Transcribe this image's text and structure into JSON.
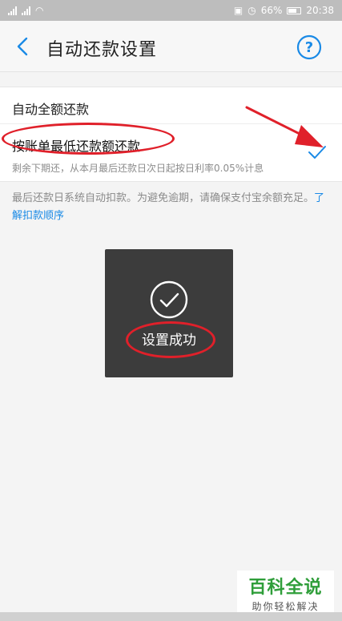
{
  "status_bar": {
    "battery": "66%",
    "time": "20:38"
  },
  "navbar": {
    "title": "自动还款设置",
    "back_icon": "chevron-left-icon",
    "help_icon": "question-circle-icon"
  },
  "options": [
    {
      "label": "自动全额还款",
      "selected": false
    },
    {
      "label": "按账单最低还款额还款",
      "sub": "剩余下期还，从本月最后还款日次日起按日利率0.05%计息",
      "selected": true
    }
  ],
  "info": {
    "text": "最后还款日系统自动扣款。为避免逾期，请确保支付宝余额充足。",
    "link": "了解扣款顺序"
  },
  "toast": {
    "icon": "check-circle-icon",
    "text": "设置成功"
  },
  "watermark": {
    "title": "百科全说",
    "subtitle": "助你轻松解决"
  },
  "colors": {
    "accent": "#1a8ae6",
    "annotation_red": "#e0202a",
    "toast_bg": "#3c3c3c"
  }
}
